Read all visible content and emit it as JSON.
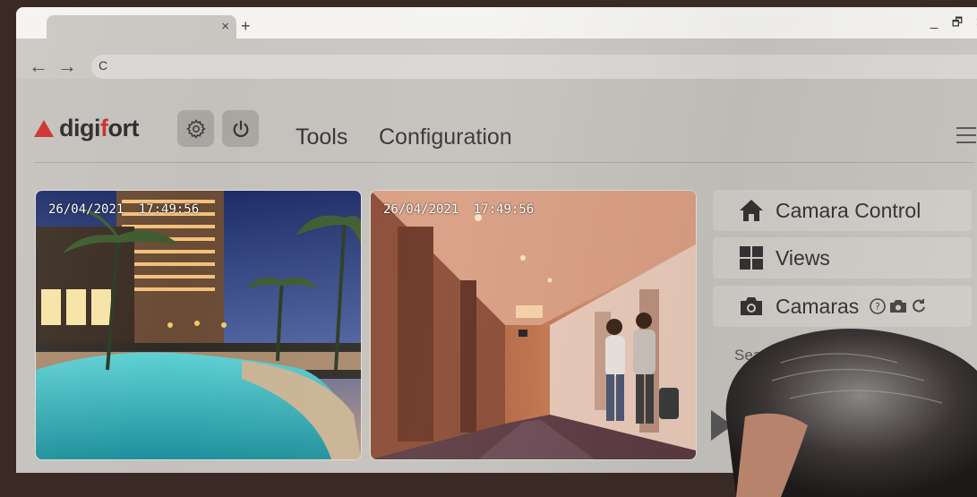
{
  "browser": {
    "tab_close": "×",
    "new_tab": "+",
    "controls": {
      "minimize": "_",
      "restore": "🗗",
      "close": "✕"
    },
    "back": "←",
    "forward": "→",
    "reload": "C"
  },
  "app": {
    "logo": {
      "prefix": "digi",
      "accent": "f",
      "suffix": "ort"
    },
    "menu": [
      {
        "label": "Tools"
      },
      {
        "label": "Configuration"
      }
    ],
    "icons": {
      "settings": "gear-icon",
      "power": "power-icon",
      "menu": "hamburger-icon"
    }
  },
  "cameras": [
    {
      "date": "26/04/2021",
      "time": "17:49:56",
      "scene": "resort pool at dusk"
    },
    {
      "date": "26/04/2021",
      "time": "17:49:56",
      "scene": "hotel corridor"
    }
  ],
  "sidebar": {
    "items": [
      {
        "label": "Camara Control",
        "icon": "home-icon"
      },
      {
        "label": "Views",
        "icon": "grid-icon"
      },
      {
        "label": "Camaras",
        "icon": "camera-icon"
      }
    ],
    "search_label": "Sear"
  },
  "colors": {
    "brand_red": "#cc2d2d",
    "panel_bg": "#c4c1bc"
  }
}
